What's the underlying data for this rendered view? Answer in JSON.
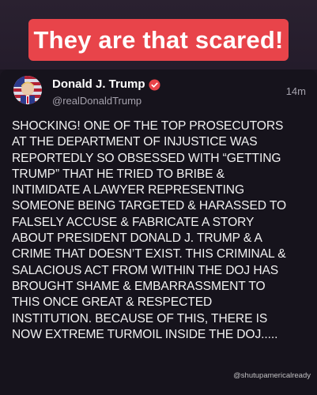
{
  "caption": {
    "text": "They are that scared!",
    "background": "#e8444a"
  },
  "post": {
    "author": {
      "display_name": "Donald J. Trump",
      "handle": "@realDonaldTrump",
      "verified_badge_color": "#e8444a"
    },
    "timestamp": "14m",
    "body_lines": [
      "SHOCKING! ONE OF THE TOP PROSECUTORS",
      "AT THE DEPARTMENT OF INJUSTICE WAS",
      "REPORTEDLY SO OBSESSED WITH “GETTING",
      "TRUMP” THAT HE TRIED TO BRIBE &",
      "INTIMIDATE A LAWYER REPRESENTING",
      "SOMEONE BEING TARGETED & HARASSED TO",
      "FALSELY ACCUSE & FABRICATE A STORY",
      "ABOUT PRESIDENT DONALD J. TRUMP & A",
      "CRIME THAT DOESN’T EXIST. THIS CRIMINAL &",
      "SALACIOUS ACT FROM WITHIN THE DOJ HAS",
      "BROUGHT SHAME & EMBARRASSMENT TO",
      "THIS ONCE GREAT & RESPECTED",
      "INSTITUTION. BECAUSE OF THIS, THERE IS",
      "NOW EXTREME TURMOIL INSIDE THE DOJ....."
    ]
  },
  "watermark": "@shutupamericalready",
  "icons": {
    "avatar": "flag-portrait-avatar",
    "verified": "verified-badge-icon"
  },
  "colors": {
    "background": "#16131c",
    "text": "#f2f2f2",
    "muted": "#a5a2ad"
  }
}
